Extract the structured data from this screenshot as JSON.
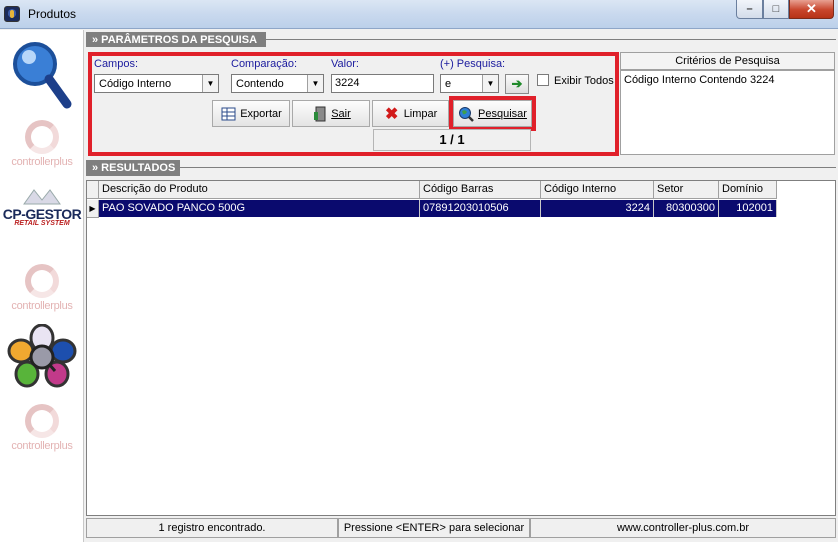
{
  "window": {
    "title": "Produtos",
    "controls": {
      "minimize": "–",
      "maximize": "□",
      "close": "✕"
    }
  },
  "sidebar": {
    "logos": [
      {
        "name": "search-magnifier"
      },
      {
        "name": "controllerplus",
        "text": "controllerplus"
      },
      {
        "name": "cp-gestor",
        "title": "CP-GESTOR",
        "subtitle": "RETAIL SYSTEM"
      },
      {
        "name": "controllerplus",
        "text": "controllerplus"
      },
      {
        "name": "flower-logo"
      },
      {
        "name": "controllerplus",
        "text": "controllerplus"
      }
    ]
  },
  "search": {
    "header": "» PARÂMETROS DA PESQUISA",
    "campos_label": "Campos:",
    "campos_value": "Código Interno",
    "comparacao_label": "Comparação:",
    "comparacao_value": "Contendo",
    "valor_label": "Valor:",
    "valor_value": "3224",
    "pesquisa_label": "(+) Pesquisa:",
    "pesquisa_value": "e",
    "exibir_todos_label": "Exibir Todos",
    "exibir_todos_checked": false,
    "buttons": {
      "exportar": "Exportar",
      "sair": "Sair",
      "limpar": "Limpar",
      "pesquisar": "Pesquisar"
    },
    "page_counter": "1 / 1"
  },
  "criteria": {
    "title": "Critérios de Pesquisa",
    "text": "Código Interno Contendo 3224"
  },
  "results": {
    "header": "» RESULTADOS",
    "columns": [
      "Descrição do Produto",
      "Código Barras",
      "Código Interno",
      "Setor",
      "Domínio"
    ],
    "rows": [
      [
        "PAO SOVADO PANCO 500G",
        "07891203010506",
        "3224",
        "80300300",
        "102001"
      ]
    ]
  },
  "status": {
    "count": "1 registro encontrado.",
    "hint": "Pressione <ENTER> para selecionar",
    "website": "www.controller-plus.com.br"
  },
  "colors": {
    "highlight_red": "#e0202a",
    "selected_row": "#0a0a6e",
    "label_blue": "#1b1b9e",
    "header_gray": "#7f7f7f"
  }
}
